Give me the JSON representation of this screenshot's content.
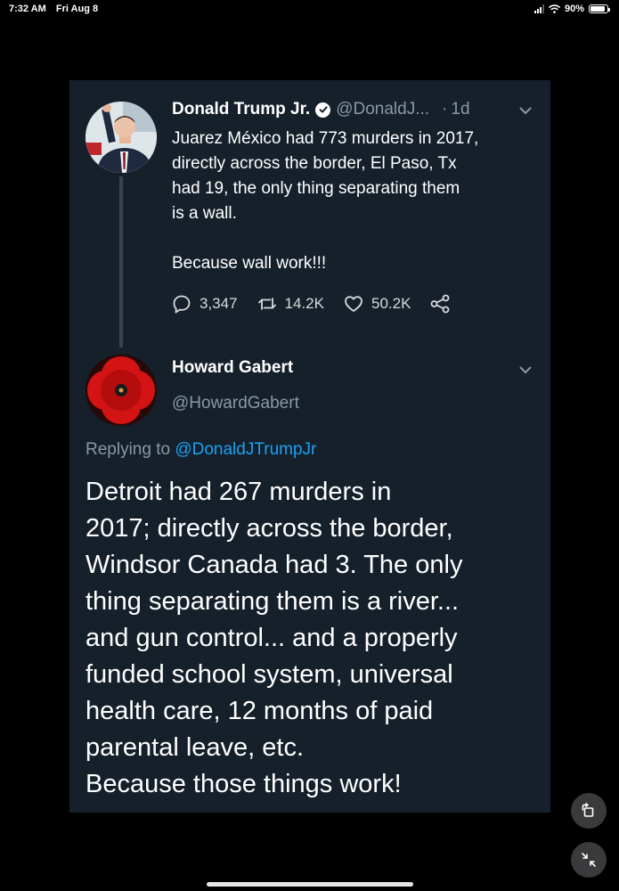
{
  "status_bar": {
    "time": "7:32 AM",
    "date": "Fri Aug 8",
    "battery": "90%",
    "battery_level": 0.9
  },
  "tweet": {
    "author_name": "Donald Trump Jr.",
    "author_handle": "@DonaldJ...",
    "separator": "·",
    "age": "1d",
    "body": "Juarez México had 773 murders in 2017,\ndirectly across the border, El Paso, Tx\nhad 19, the only thing separating them\nis a wall.\n\nBecause wall work!!!",
    "replies": "3,347",
    "retweets": "14.2K",
    "likes": "50.2K"
  },
  "reply": {
    "author_name": "Howard Gabert",
    "author_handle": "@HowardGabert",
    "replying_prefix": "Replying to",
    "replying_to": "@DonaldJTrumpJr",
    "body": "Detroit had 267 murders in\n2017; directly across the border,\nWindsor Canada had 3.  The only\nthing separating them is a river...\nand gun control... and a properly\nfunded school system, universal\nhealth care, 12 months of paid\nparental leave, etc.\nBecause those things work!"
  },
  "colors": {
    "background": "#000000",
    "card_background": "#15202b",
    "muted_text": "#8899a6",
    "link": "#1da1f2"
  },
  "icons": [
    "verified-badge-icon",
    "chevron-down-icon",
    "reply-icon",
    "retweet-icon",
    "like-icon",
    "share-icon",
    "rotate-screen-icon",
    "collapse-icon"
  ]
}
